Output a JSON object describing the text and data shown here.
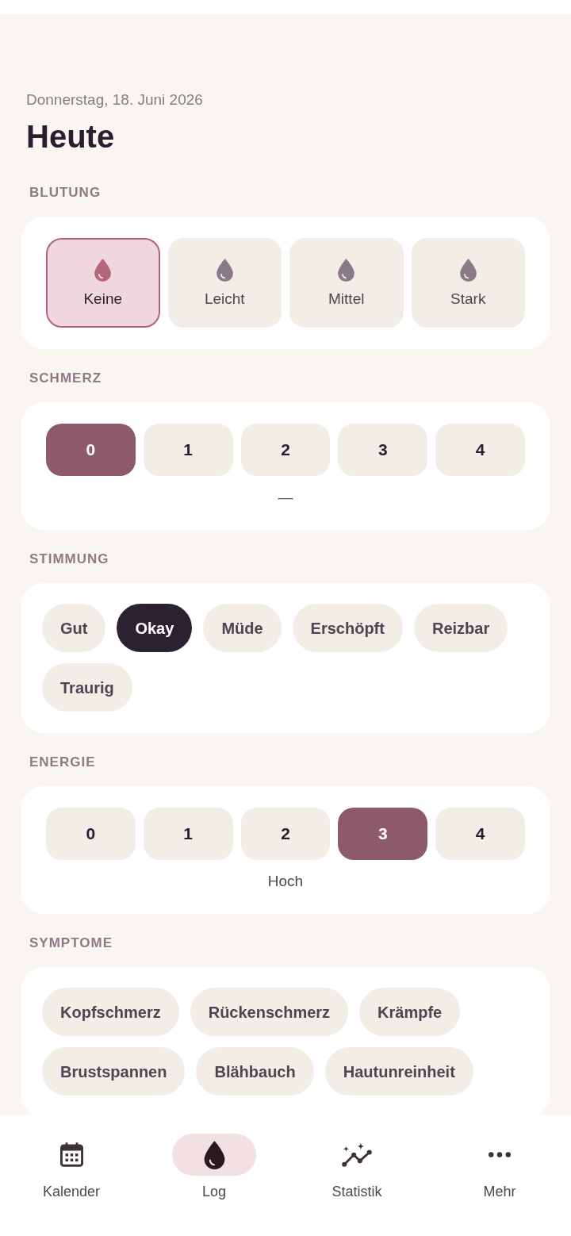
{
  "header": {
    "date": "Donnerstag, 18. Juni 2026",
    "title": "Heute"
  },
  "sections": [
    {
      "kind": "bleeding",
      "title": "BLUTUNG",
      "options": [
        {
          "label": "Keine",
          "selected": true
        },
        {
          "label": "Leicht",
          "selected": false
        },
        {
          "label": "Mittel",
          "selected": false
        },
        {
          "label": "Stark",
          "selected": false
        }
      ]
    },
    {
      "kind": "scale",
      "title": "SCHMERZ",
      "options": [
        {
          "label": "0",
          "selected": true
        },
        {
          "label": "1",
          "selected": false
        },
        {
          "label": "2",
          "selected": false
        },
        {
          "label": "3",
          "selected": false
        },
        {
          "label": "4",
          "selected": false
        }
      ],
      "caption": "—"
    },
    {
      "kind": "chips",
      "title": "STIMMUNG",
      "options": [
        {
          "label": "Gut",
          "selected": false
        },
        {
          "label": "Okay",
          "selected": true
        },
        {
          "label": "Müde",
          "selected": false
        },
        {
          "label": "Erschöpft",
          "selected": false
        },
        {
          "label": "Reizbar",
          "selected": false
        },
        {
          "label": "Traurig",
          "selected": false
        }
      ]
    },
    {
      "kind": "scale",
      "title": "ENERGIE",
      "options": [
        {
          "label": "0",
          "selected": false
        },
        {
          "label": "1",
          "selected": false
        },
        {
          "label": "2",
          "selected": false
        },
        {
          "label": "3",
          "selected": true
        },
        {
          "label": "4",
          "selected": false
        }
      ],
      "caption": "Hoch"
    },
    {
      "kind": "chips",
      "title": "SYMPTOME",
      "options": [
        {
          "label": "Kopfschmerz",
          "selected": false
        },
        {
          "label": "Rückenschmerz",
          "selected": false
        },
        {
          "label": "Krämpfe",
          "selected": false
        },
        {
          "label": "Brustspannen",
          "selected": false
        },
        {
          "label": "Blähbauch",
          "selected": false
        },
        {
          "label": "Hautunreinheit",
          "selected": false
        }
      ]
    }
  ],
  "bottom_nav": [
    {
      "label": "Kalender",
      "selected": false
    },
    {
      "label": "Log",
      "selected": true
    },
    {
      "label": "Statistik",
      "selected": false
    },
    {
      "label": "Mehr",
      "selected": false
    }
  ]
}
